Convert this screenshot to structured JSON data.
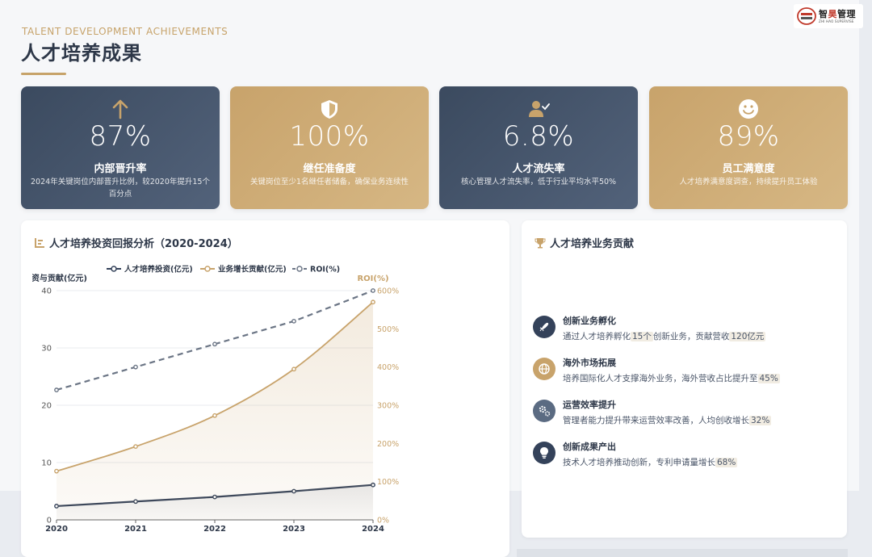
{
  "header": {
    "subtitle": "TALENT DEVELOPMENT ACHIEVEMENTS",
    "title": "人才培养成果"
  },
  "logo": {
    "cn_prefix": "智",
    "cn_red": "昊",
    "cn_suffix": "管理",
    "en": "ZHI HAO SUPERVISE"
  },
  "kpis": [
    {
      "value": "87%",
      "label": "内部晋升率",
      "desc": "2024年关键岗位内部晋升比例，较2020年提升15个百分点",
      "icon": "arrow-up-icon",
      "style": "dark"
    },
    {
      "value": "100%",
      "label": "继任准备度",
      "desc": "关键岗位至少1名继任者储备，确保业务连续性",
      "icon": "shield-icon",
      "style": "gold"
    },
    {
      "value": "6.8%",
      "label": "人才流失率",
      "desc": "核心管理人才流失率，低于行业平均水平50%",
      "icon": "user-check-icon",
      "style": "dark"
    },
    {
      "value": "89%",
      "label": "员工满意度",
      "desc": "人才培养满意度调查，持续提升员工体验",
      "icon": "smile-icon",
      "style": "gold"
    }
  ],
  "roi_panel": {
    "title": "人才培养投资回报分析（2020-2024）"
  },
  "chart_data": {
    "type": "line",
    "x": [
      "2020",
      "2021",
      "2022",
      "2023",
      "2024"
    ],
    "series": [
      {
        "name": "人才培养投资(亿元)",
        "values": [
          2.4,
          3.2,
          4.0,
          5.0,
          6.1
        ],
        "axis": "left",
        "color": "#34425a",
        "style": "solid"
      },
      {
        "name": "业务增长贡献(亿元)",
        "values": [
          8.5,
          12.8,
          18.2,
          26.3,
          38.0
        ],
        "axis": "left",
        "color": "#c8a36b",
        "style": "solid",
        "area": true
      },
      {
        "name": "ROI(%)",
        "values": [
          340,
          400,
          460,
          520,
          600
        ],
        "axis": "right",
        "color": "#6b7585",
        "style": "dashed"
      }
    ],
    "ylabel": "投资与贡献(亿元)",
    "y2label": "ROI(%)",
    "ylim": [
      0,
      40
    ],
    "y2lim": [
      0,
      600
    ],
    "yticks": [
      "0",
      "10",
      "20",
      "30",
      "40"
    ],
    "y2ticks": [
      "0%",
      "100%",
      "200%",
      "300%",
      "400%",
      "500%",
      "600%"
    ],
    "legend": "top-center",
    "grid": true
  },
  "contrib_panel": {
    "title": "人才培养业务贡献",
    "items": [
      {
        "title": "创新业务孵化",
        "pre": "通过人才培养孵化",
        "h1": "15个",
        "mid": "创新业务，贡献营收",
        "h2": "120亿元",
        "icon": "rocket-icon",
        "style": "dark"
      },
      {
        "title": "海外市场拓展",
        "pre": "培养国际化人才支撑海外业务，海外营收占比提升至",
        "h1": "45%",
        "mid": "",
        "h2": "",
        "icon": "globe-icon",
        "style": "gold"
      },
      {
        "title": "运营效率提升",
        "pre": "管理者能力提升带来运营效率改善，人均创收增长",
        "h1": "32%",
        "mid": "",
        "h2": "",
        "icon": "gears-icon",
        "style": "gray"
      },
      {
        "title": "创新成果产出",
        "pre": "技术人才培养推动创新，专利申请量增长",
        "h1": "68%",
        "mid": "",
        "h2": "",
        "icon": "lightbulb-icon",
        "style": "dark"
      }
    ]
  }
}
